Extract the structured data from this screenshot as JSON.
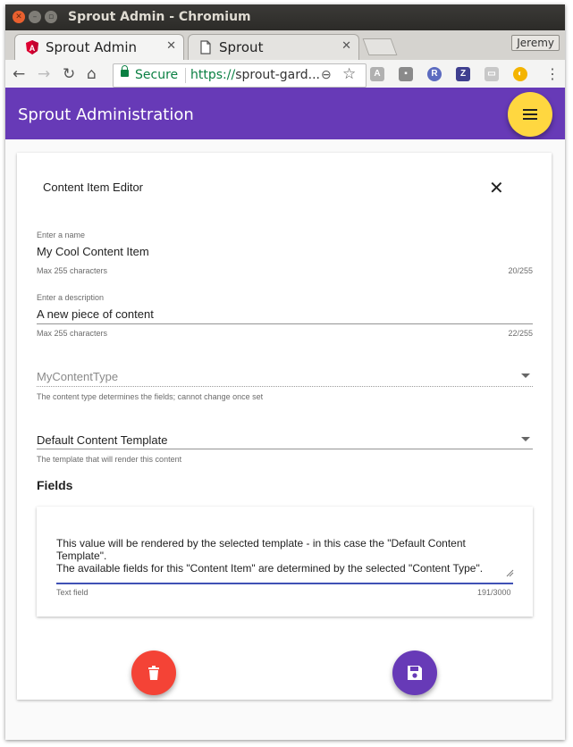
{
  "window": {
    "title": "Sprout Admin - Chromium"
  },
  "tabs": [
    {
      "label": "Sprout Admin",
      "icon": "angular-icon",
      "active": true
    },
    {
      "label": "Sprout",
      "icon": "page-icon",
      "active": false
    }
  ],
  "profile": "Jeremy",
  "toolbar": {
    "secure_label": "Secure",
    "url_scheme": "https://",
    "url_rest": "sprout-gard..."
  },
  "app": {
    "title": "Sprout Administration",
    "menu_icon": "hamburger-icon",
    "accent": "#673ab7",
    "fab_color": "#ffd740"
  },
  "editor": {
    "title": "Content Item Editor",
    "name": {
      "label": "Enter a name",
      "value": "My Cool Content Item",
      "hint": "Max 255 characters",
      "counter": "20/255"
    },
    "description": {
      "label": "Enter a description",
      "value": "A new piece of content",
      "hint": "Max 255 characters",
      "counter": "22/255"
    },
    "content_type": {
      "value": "MyContentType",
      "hint": "The content type determines the fields; cannot change once set"
    },
    "template": {
      "value": "Default Content Template",
      "hint": "The template that will render this content"
    },
    "fields_heading": "Fields",
    "text_field": {
      "line1": "This value will be rendered by the selected template - in this case the \"Default Content",
      "line2": "Template\".",
      "line3": "The available fields for this \"Content Item\" are determined by the selected \"Content Type\".",
      "hint": "Text field",
      "counter": "191/3000"
    }
  },
  "actions": {
    "delete_icon": "trash-icon",
    "save_icon": "floppy-disk-icon",
    "delete_color": "#f44336",
    "save_color": "#673ab7"
  }
}
